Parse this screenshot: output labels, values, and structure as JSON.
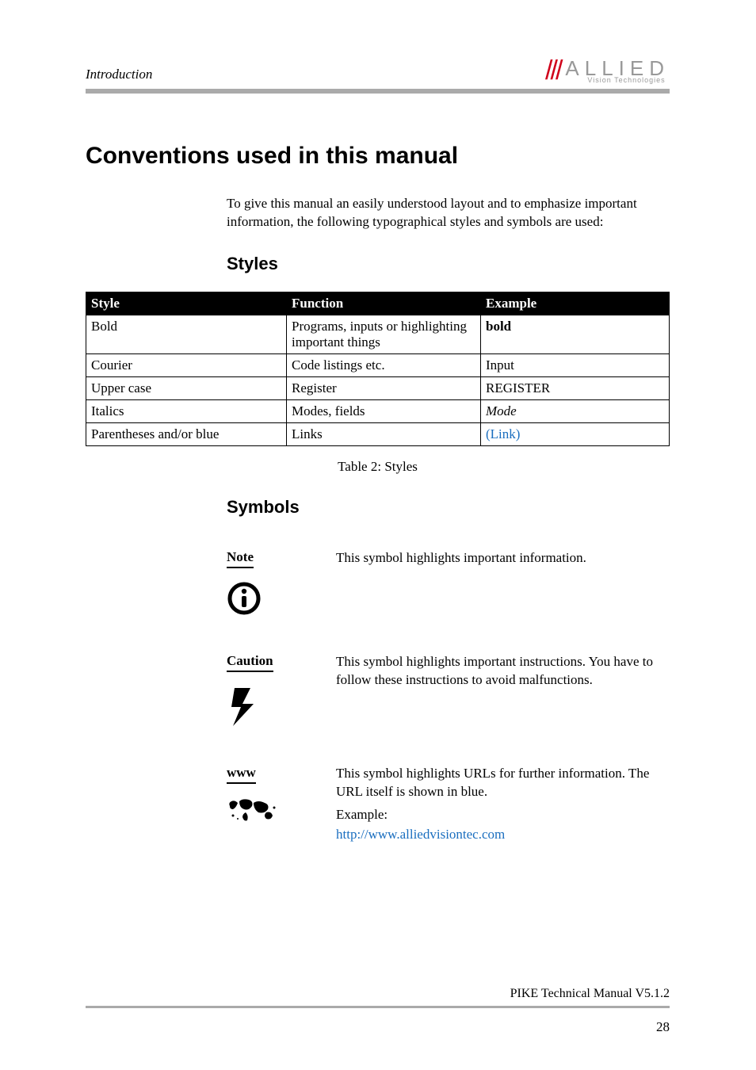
{
  "header": {
    "section": "Introduction",
    "logo_big": "ALLIED",
    "logo_small": "Vision Technologies"
  },
  "h1": "Conventions used in this manual",
  "intro": "To give this manual an easily understood layout and to emphasize important information, the following typographical styles and symbols are used:",
  "h2_styles": "Styles",
  "table": {
    "headers": {
      "c1": "Style",
      "c2": "Function",
      "c3": "Example"
    },
    "rows": [
      {
        "c1": "Bold",
        "c2": "Programs, inputs or highlighting important things",
        "c3": "bold",
        "cls": "ex-bold"
      },
      {
        "c1": "Courier",
        "c2": "Code listings etc.",
        "c3": "Input",
        "cls": "ex-code"
      },
      {
        "c1": "Upper case",
        "c2": "Register",
        "c3": "REGISTER",
        "cls": ""
      },
      {
        "c1": "Italics",
        "c2": "Modes, fields",
        "c3": "Mode",
        "cls": "ex-italic"
      },
      {
        "c1": "Parentheses and/or blue",
        "c2": "Links",
        "c3": "(Link)",
        "cls": "ex-link"
      }
    ],
    "caption": "Table 2: Styles"
  },
  "h2_symbols": "Symbols",
  "symbols": {
    "note": {
      "label": "Note",
      "text": "This symbol highlights important information."
    },
    "caution": {
      "label": "Caution",
      "text": "This symbol highlights important instructions. You have to follow these instructions to avoid malfunctions."
    },
    "www": {
      "label": "www",
      "text": "This symbol highlights URLs for further information. The URL itself is shown in blue.",
      "example_label": "Example:",
      "url": "http://www.alliedvisiontec.com"
    }
  },
  "footer": {
    "doc": "PIKE Technical Manual V5.1.2",
    "page": "28"
  }
}
